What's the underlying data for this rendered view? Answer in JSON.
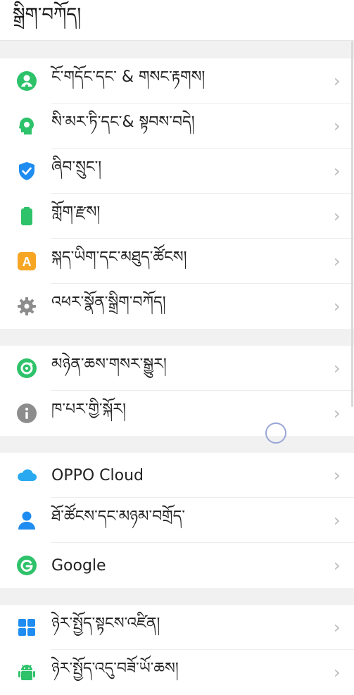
{
  "header": {
    "title": "སྒྲིག་བཀོད།"
  },
  "groups": [
    {
      "items": [
        {
          "label": "ངོ་གདོང་དང་ & གསང་རྟགས།",
          "icon": "face-icon"
        },
        {
          "label": "སི་མར་ཏི་དང་& སྟབས་བདེ།",
          "icon": "smart-icon"
        },
        {
          "label": "ཞིབ་སྲུང་།",
          "icon": "shield-icon"
        },
        {
          "label": "གློག་རྫས།",
          "icon": "battery-icon"
        },
        {
          "label": "སྐད་ཡིག་དང་མཐུད་ཚོངས།",
          "icon": "language-icon"
        },
        {
          "label": "འཕར་སྣོན་སྒྲིག་བཀོད།",
          "icon": "gear-icon"
        }
      ]
    },
    {
      "items": [
        {
          "label": "མཉེན་ཆས་གསར་སྒྱུར།",
          "icon": "update-icon"
        },
        {
          "label": "ཁ་པར་གྱི་སྐོར།",
          "icon": "info-icon"
        }
      ]
    },
    {
      "items": [
        {
          "label": "OPPO Cloud",
          "icon": "cloud-icon"
        },
        {
          "label": "ཐོ་ཚོངས་དང་མཉམ་བགྲོད་",
          "icon": "account-icon"
        },
        {
          "label": "Google",
          "icon": "google-icon"
        }
      ]
    },
    {
      "items": [
        {
          "label": "ཉེར་སྤྱོད་སྟངས་འཛིན།",
          "icon": "apps-icon"
        },
        {
          "label": "ཉེར་སྤྱོད་འདུ་བཟོ་ཡོ་ཆས།",
          "icon": "android-icon"
        }
      ]
    }
  ],
  "colors": {
    "green": "#2ec26a",
    "blue": "#1e8cf0",
    "orange": "#f6a623",
    "gray": "#8d8d8d"
  }
}
